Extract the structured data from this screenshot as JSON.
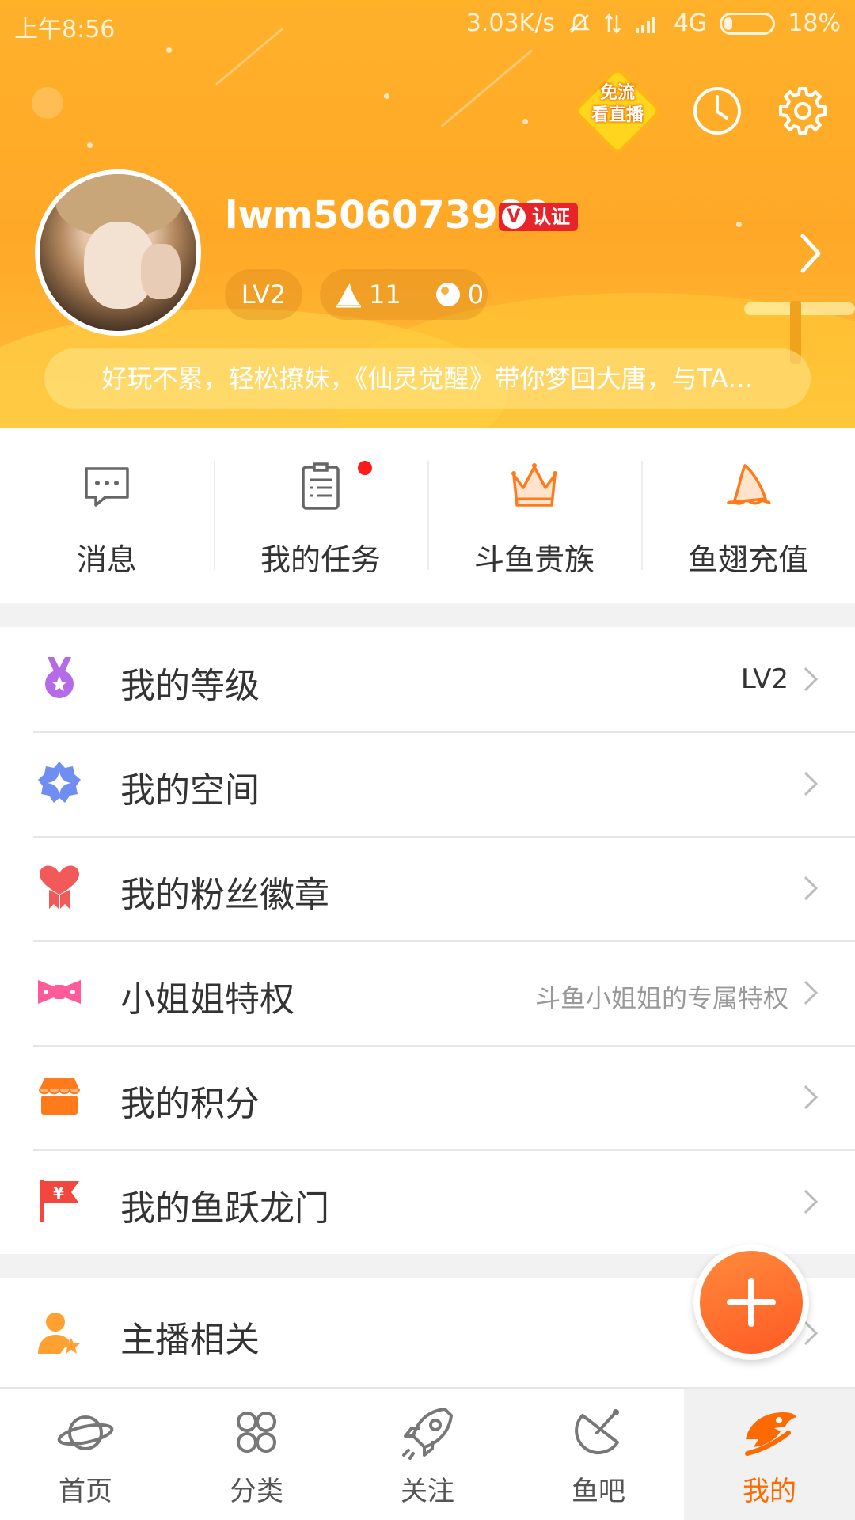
{
  "status_bar": {
    "time": "上午8:56",
    "net_speed": "3.03K/s",
    "network": "4G",
    "battery": "18%"
  },
  "header": {
    "free_badge_line1": "免流",
    "free_badge_line2": "看直播",
    "username": "lwm506073982",
    "verify_label": "认证",
    "verify_mark": "V",
    "level": "LV2",
    "fins": "11",
    "coins": "0",
    "ad_text": "好玩不累，轻松撩妹，《仙灵觉醒》带你梦回大唐，与TA…"
  },
  "quick_actions": [
    {
      "label": "消息",
      "icon": "message-icon"
    },
    {
      "label": "我的任务",
      "icon": "task-icon",
      "has_notification": true
    },
    {
      "label": "斗鱼贵族",
      "icon": "crown-icon"
    },
    {
      "label": "鱼翅充值",
      "icon": "fin-icon"
    }
  ],
  "menu": [
    {
      "label": "我的等级",
      "value": "LV2",
      "icon": "medal-icon"
    },
    {
      "label": "我的空间",
      "value": "",
      "icon": "sparkle-icon"
    },
    {
      "label": "我的粉丝徽章",
      "value": "",
      "icon": "heart-badge-icon"
    },
    {
      "label": "小姐姐特权",
      "value": "斗鱼小姐姐的专属特权",
      "icon": "bow-icon"
    },
    {
      "label": "我的积分",
      "value": "",
      "icon": "shop-icon"
    },
    {
      "label": "我的鱼跃龙门",
      "value": "",
      "icon": "flag-icon"
    }
  ],
  "menu2": [
    {
      "label": "主播相关",
      "icon": "anchor-user-icon"
    }
  ],
  "bottom_nav": [
    {
      "label": "首页",
      "icon": "planet-icon",
      "active": false
    },
    {
      "label": "分类",
      "icon": "grid-icon",
      "active": false
    },
    {
      "label": "关注",
      "icon": "rocket-icon",
      "active": false
    },
    {
      "label": "鱼吧",
      "icon": "satellite-icon",
      "active": false
    },
    {
      "label": "我的",
      "icon": "fish-icon",
      "active": true
    }
  ],
  "colors": {
    "header_orange": "#ffa827",
    "accent_orange": "#ff6a00",
    "notification_red": "#ff1a1a",
    "verify_red": "#e8242b"
  }
}
